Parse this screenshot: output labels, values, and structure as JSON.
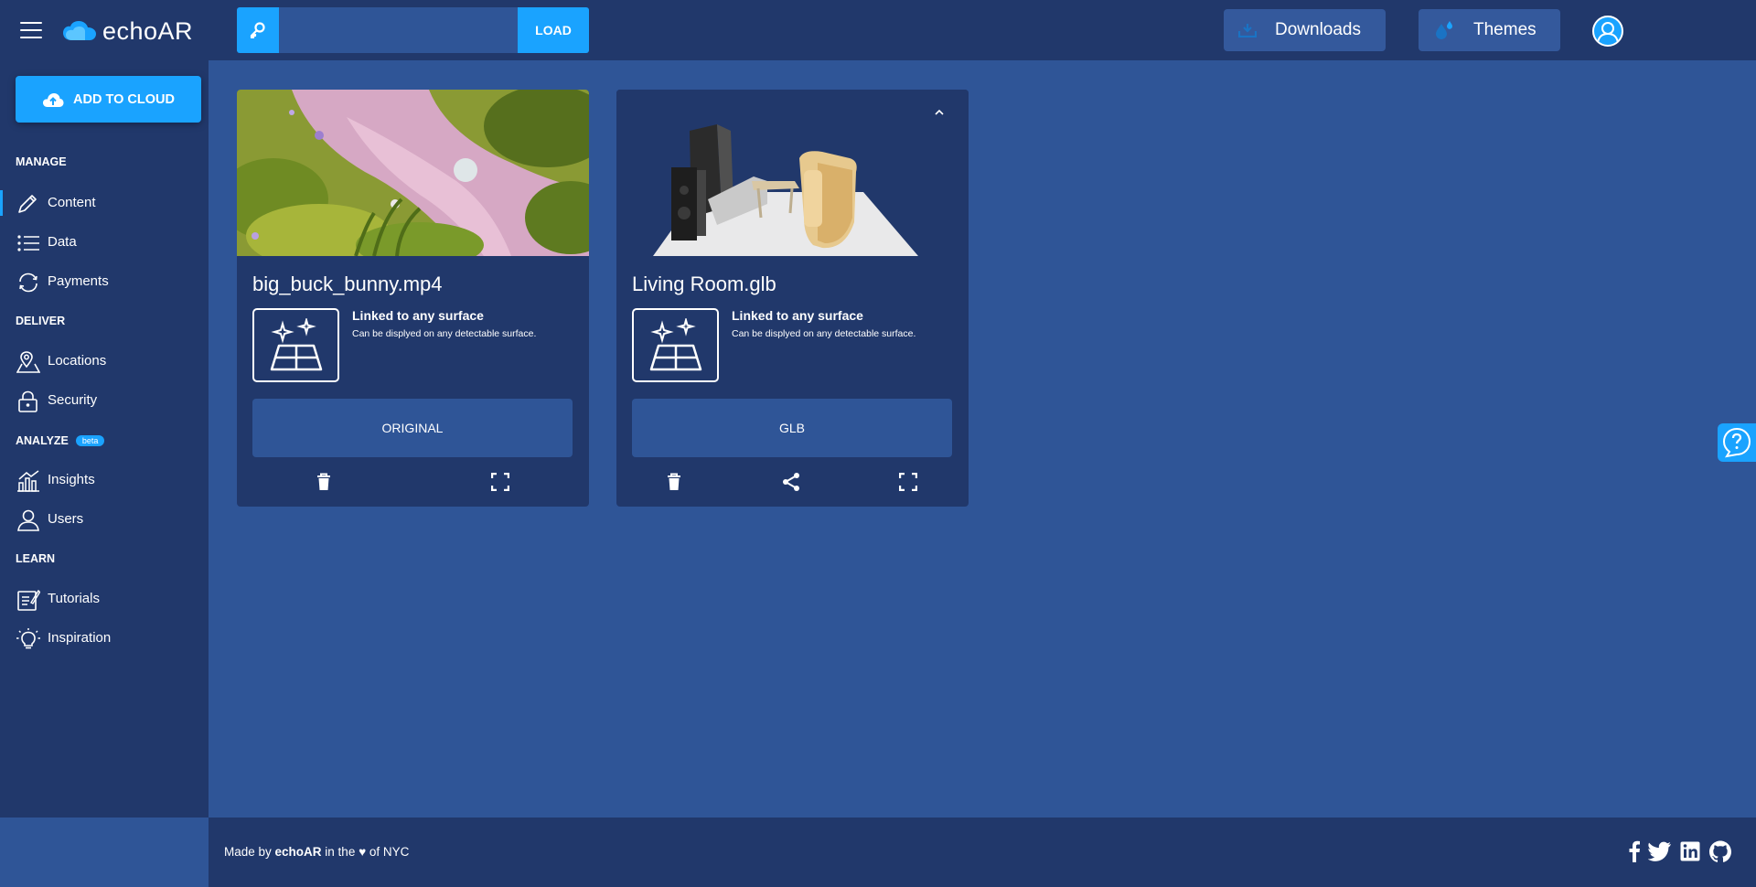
{
  "header": {
    "logo_text": "echoAR",
    "key_placeholder": "",
    "load_label": "LOAD",
    "downloads_label": "Downloads",
    "themes_label": "Themes"
  },
  "sidebar": {
    "add_label": "ADD TO CLOUD",
    "sections": {
      "manage": "MANAGE",
      "deliver": "DELIVER",
      "analyze": "ANALYZE",
      "analyze_badge": "beta",
      "learn": "LEARN"
    },
    "items": [
      {
        "label": "Content",
        "icon": "pencil-icon",
        "active": true
      },
      {
        "label": "Data",
        "icon": "list-icon"
      },
      {
        "label": "Payments",
        "icon": "refresh-icon"
      },
      {
        "label": "Locations",
        "icon": "location-icon"
      },
      {
        "label": "Security",
        "icon": "lock-icon"
      },
      {
        "label": "Insights",
        "icon": "chart-icon"
      },
      {
        "label": "Users",
        "icon": "user-icon"
      },
      {
        "label": "Tutorials",
        "icon": "notepad-icon"
      },
      {
        "label": "Inspiration",
        "icon": "lightbulb-icon"
      }
    ]
  },
  "cards": [
    {
      "title": "big_buck_bunny.mp4",
      "surface_title": "Linked to any surface",
      "surface_desc": "Can be displyed on any detectable surface.",
      "format_label": "ORIGINAL",
      "thumb_icon": "video-thumbnail",
      "actions": [
        "trash-icon",
        "fullscreen-icon"
      ]
    },
    {
      "title": "Living Room.glb",
      "surface_title": "Linked to any surface",
      "surface_desc": "Can be displyed on any detectable surface.",
      "format_label": "GLB",
      "thumb_icon": "living-room-3d-thumbnail",
      "actions": [
        "trash-icon",
        "share-icon",
        "fullscreen-icon"
      ]
    }
  ],
  "footer": {
    "prefix": "Made by ",
    "brand": "echoAR",
    "middle": " in the ",
    "heart": "♥",
    "suffix": " of NYC"
  },
  "colors": {
    "background": "#2f5597",
    "panel": "#21386b",
    "accent": "#1aa3ff"
  }
}
